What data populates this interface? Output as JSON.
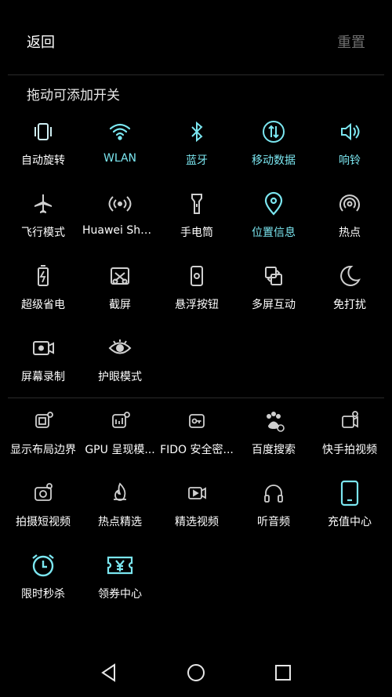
{
  "header": {
    "back_label": "返回",
    "reset_label": "重置"
  },
  "section": {
    "title": "拖动可添加开关"
  },
  "accent": "#7be6f0",
  "system_tiles": [
    {
      "label": "自动旋转",
      "icon": "auto-rotate-icon"
    },
    {
      "label": "WLAN",
      "icon": "wifi-icon"
    },
    {
      "label": "蓝牙",
      "icon": "bluetooth-icon"
    },
    {
      "label": "移动数据",
      "icon": "mobile-data-icon"
    },
    {
      "label": "响铃",
      "icon": "ring-icon"
    },
    {
      "label": "飞行模式",
      "icon": "airplane-icon"
    },
    {
      "label": "Huawei Share",
      "icon": "huawei-share-icon"
    },
    {
      "label": "手电筒",
      "icon": "flashlight-icon"
    },
    {
      "label": "位置信息",
      "icon": "location-icon"
    },
    {
      "label": "热点",
      "icon": "hotspot-icon"
    },
    {
      "label": "超级省电",
      "icon": "battery-saver-icon"
    },
    {
      "label": "截屏",
      "icon": "screenshot-icon"
    },
    {
      "label": "悬浮按钮",
      "icon": "floating-button-icon"
    },
    {
      "label": "多屏互动",
      "icon": "multi-screen-icon"
    },
    {
      "label": "免打扰",
      "icon": "do-not-disturb-icon"
    },
    {
      "label": "屏幕录制",
      "icon": "screen-record-icon"
    },
    {
      "label": "护眼模式",
      "icon": "eye-comfort-icon"
    }
  ],
  "app_tiles": [
    {
      "label": "显示布局边界",
      "icon": "layout-bounds-icon"
    },
    {
      "label": "GPU 呈现模...",
      "icon": "gpu-render-icon"
    },
    {
      "label": "FIDO 安全密...",
      "icon": "fido-key-icon"
    },
    {
      "label": "百度搜索",
      "icon": "baidu-search-icon"
    },
    {
      "label": "快手拍视频",
      "icon": "kuaishou-video-icon"
    },
    {
      "label": "拍摄短视频",
      "icon": "short-video-icon"
    },
    {
      "label": "热点精选",
      "icon": "hot-picks-icon"
    },
    {
      "label": "精选视频",
      "icon": "featured-video-icon"
    },
    {
      "label": "听音频",
      "icon": "audio-icon"
    },
    {
      "label": "充值中心",
      "icon": "recharge-center-icon"
    },
    {
      "label": "限时秒杀",
      "icon": "flash-sale-icon"
    },
    {
      "label": "领券中心",
      "icon": "coupon-center-icon"
    }
  ]
}
